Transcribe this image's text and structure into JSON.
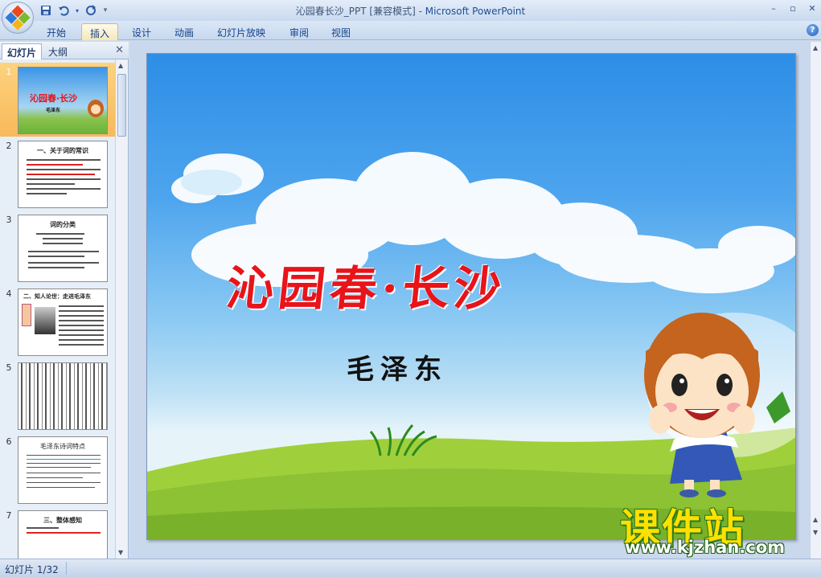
{
  "window": {
    "title": "沁园春长沙_PPT [兼容模式]",
    "separator": " - ",
    "app_name": "Microsoft PowerPoint"
  },
  "ribbon": {
    "tabs": [
      {
        "label": "开始",
        "active": false
      },
      {
        "label": "插入",
        "active": true
      },
      {
        "label": "设计",
        "active": false
      },
      {
        "label": "动画",
        "active": false
      },
      {
        "label": "幻灯片放映",
        "active": false
      },
      {
        "label": "审阅",
        "active": false
      },
      {
        "label": "视图",
        "active": false
      }
    ]
  },
  "icons": {
    "office_button": "office-logo-icon",
    "save": "save-icon",
    "undo": "undo-icon",
    "redo": "redo-icon",
    "qat_more": "chevron-down-icon",
    "minimize": "minimize-icon",
    "maximize": "restore-icon",
    "close": "close-icon",
    "help": "help-icon"
  },
  "left_pane": {
    "tabs": [
      {
        "label": "幻灯片",
        "active": true
      },
      {
        "label": "大纲",
        "active": false
      }
    ],
    "slides": [
      {
        "num": "1",
        "title": "",
        "selected": true
      },
      {
        "num": "2",
        "title": "一、关于词的常识",
        "selected": false
      },
      {
        "num": "3",
        "title": "词的分类",
        "selected": false
      },
      {
        "num": "4",
        "title": "二、知人论世：走进毛泽东",
        "selected": false
      },
      {
        "num": "5",
        "title": "",
        "selected": false
      },
      {
        "num": "6",
        "title": "毛泽东诗词特点",
        "selected": false
      },
      {
        "num": "7",
        "title": "三、整体感知",
        "selected": false
      }
    ]
  },
  "slide": {
    "title": "沁园春·长沙",
    "author": "毛泽东"
  },
  "watermark": {
    "cn": "课件站",
    "url": "www.kjzhan.com"
  },
  "status": {
    "slide_counter": "幻灯片 1/32"
  },
  "colors": {
    "title_red": "#e8141a",
    "selected_thumb": "#f8b95a",
    "ribbon_text": "#15428b"
  }
}
